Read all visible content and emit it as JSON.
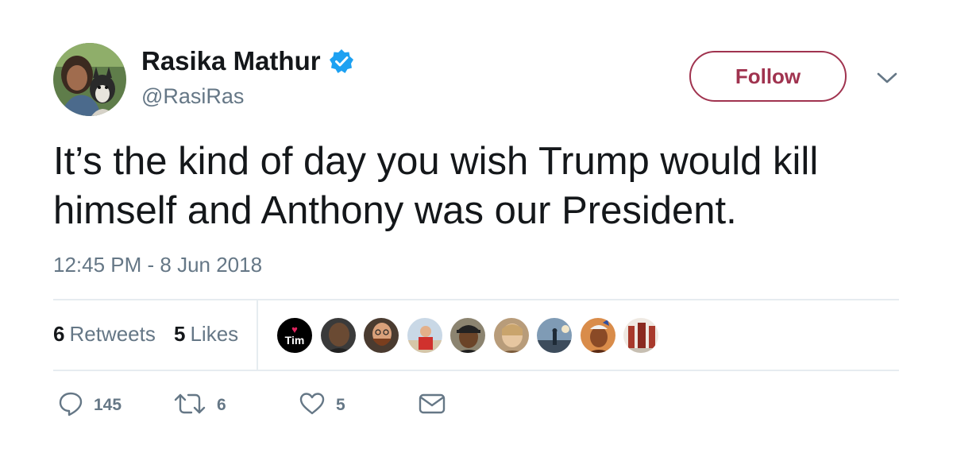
{
  "user": {
    "display_name": "Rasika Mathur",
    "handle": "@RasiRas",
    "verified": true,
    "avatar_icon": "profile-photo-with-dog"
  },
  "follow_button": {
    "label": "Follow",
    "color": "#a0334f"
  },
  "menu": {
    "icon": "chevron-down-icon"
  },
  "tweet": {
    "text": "It’s the kind of day you wish Trump would kill himself and Anthony was our President.",
    "timestamp": "12:45 PM - 8 Jun 2018"
  },
  "stats": {
    "retweets_count": "6",
    "retweets_label": "Retweets",
    "likes_count": "5",
    "likes_label": "Likes"
  },
  "likers": [
    {
      "name": "tim",
      "label_symbol": "♥",
      "label_text": "Tim"
    },
    {
      "name": "user-2"
    },
    {
      "name": "user-3"
    },
    {
      "name": "user-4"
    },
    {
      "name": "user-5"
    },
    {
      "name": "user-6"
    },
    {
      "name": "user-7"
    },
    {
      "name": "user-8"
    },
    {
      "name": "user-9"
    }
  ],
  "actions": {
    "reply_count": "145",
    "retweet_count": "6",
    "like_count": "5"
  },
  "colors": {
    "text": "#14171a",
    "secondary": "#657786",
    "verified_blue": "#1da1f2",
    "divider": "#e6ecf0"
  }
}
